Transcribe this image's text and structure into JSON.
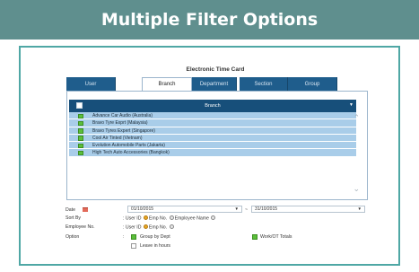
{
  "banner": {
    "title": "Multiple Filter Options"
  },
  "dialog": {
    "title": "Electronic Time Card"
  },
  "tabs": [
    {
      "label": "User",
      "active": false
    },
    {
      "label": "Branch",
      "active": true
    },
    {
      "label": "Department",
      "active": false
    },
    {
      "label": "Section",
      "active": false
    },
    {
      "label": "Group",
      "active": false
    }
  ],
  "grid": {
    "header": "Branch",
    "rows": [
      {
        "label": "Advance Car Audio (Australia)",
        "checked": true
      },
      {
        "label": "Bravo Tyre Exprt (Malaysia)",
        "checked": true
      },
      {
        "label": "Bravo Tyres Expert (Singapore)",
        "checked": true
      },
      {
        "label": "Cool Air Tinted (Vietnam)",
        "checked": true
      },
      {
        "label": "Evolution Automobile Parts (Jakarta)",
        "checked": true
      },
      {
        "label": "High Tech Auto Accessories (Bangkok)",
        "checked": true
      }
    ]
  },
  "form": {
    "date_label": "Date",
    "date_from": "01/10/2015",
    "date_sep": "~",
    "date_to": "31/10/2015",
    "sort_label": "Sort By",
    "sort_prefix": ": User ID",
    "sort_opt1": "Emp No.",
    "sort_opt2": "Employee Name",
    "empno_label": "Employee No.",
    "empno_prefix": ": User ID",
    "empno_opt1": "Emp No.",
    "option_label": "Option",
    "opt_group_by_dept": "Group by Dept",
    "opt_work_ot_totals": "Work/OT Totals",
    "opt_leave_in_hours": "Leave in hours",
    "colon": ":"
  },
  "colors": {
    "banner": "#5f8f8e",
    "frame_border": "#4fa7a5",
    "tab_bg": "#1f5d8c",
    "row_bg": "#a9cde9",
    "checkbox_on": "#5bbf3a",
    "radio_on": "#e9a826"
  }
}
